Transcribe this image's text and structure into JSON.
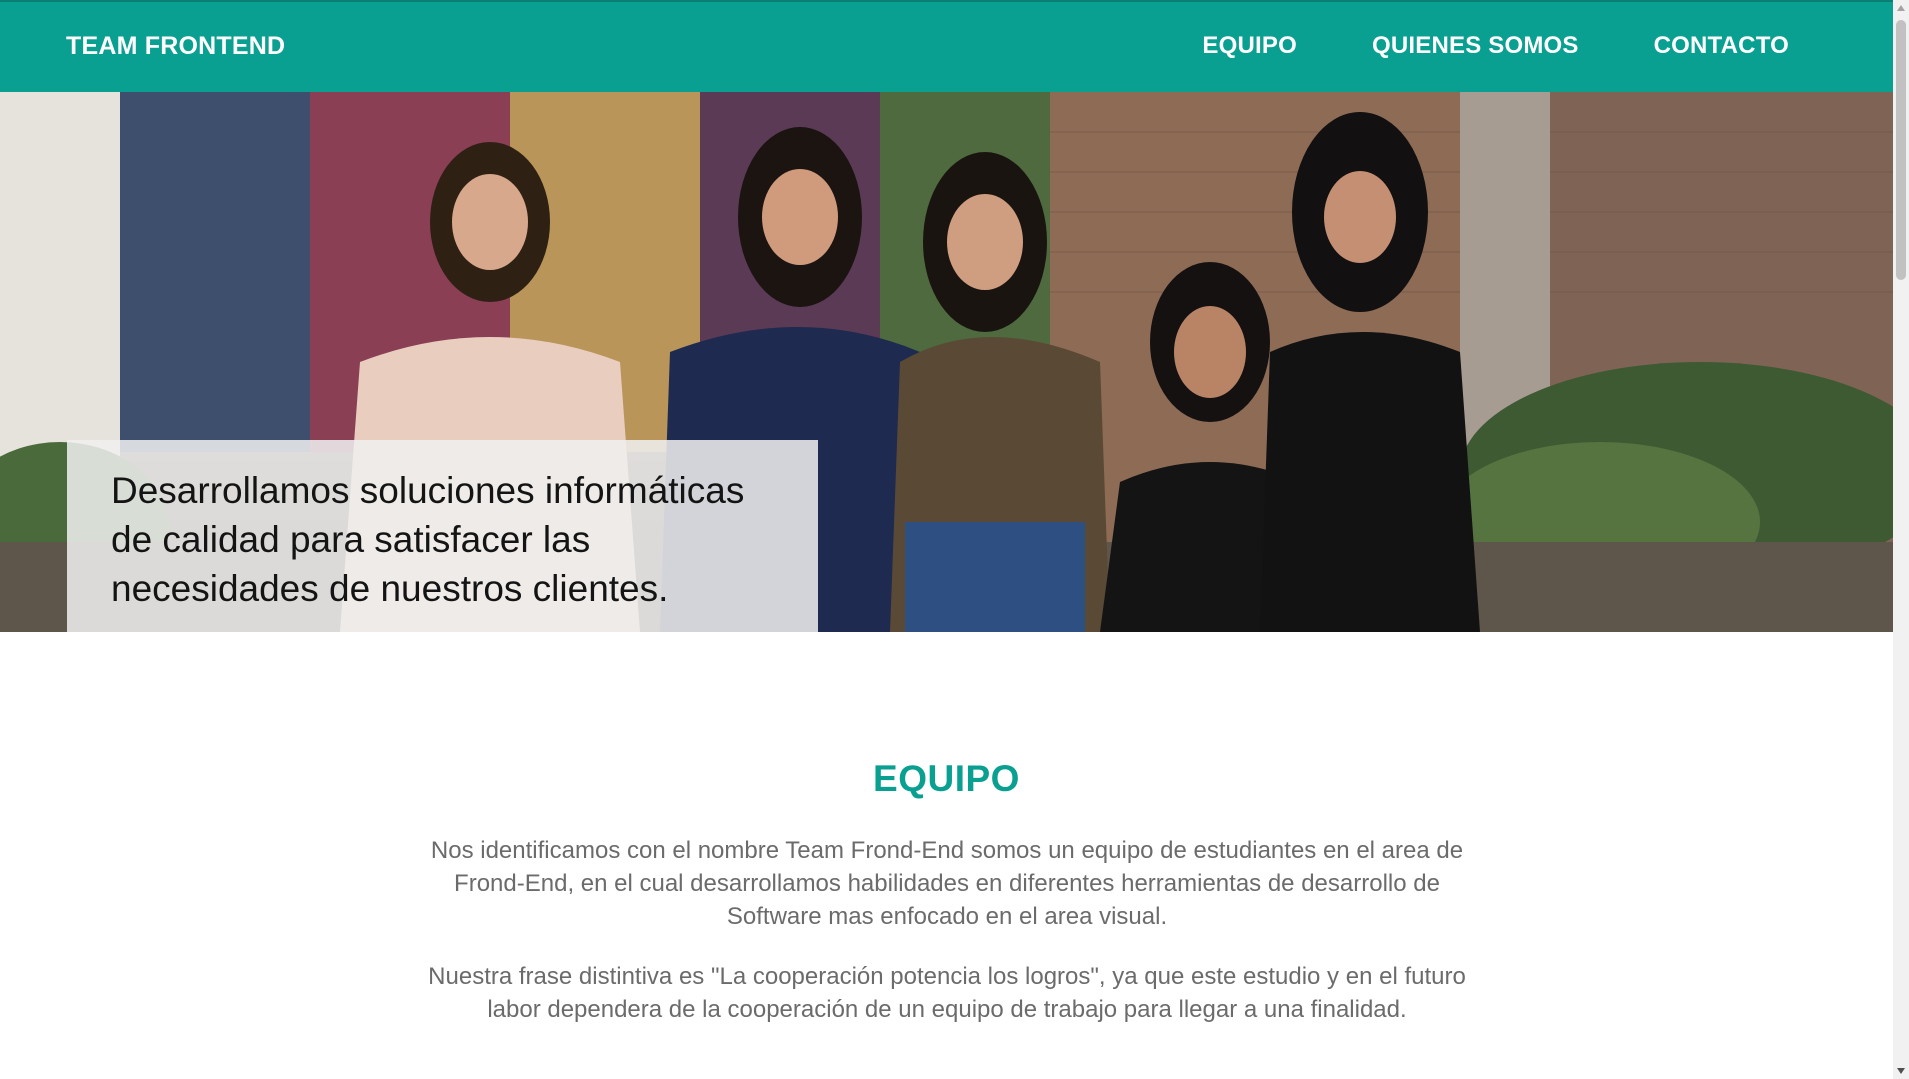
{
  "navbar": {
    "brand": "TEAM FRONTEND",
    "links": [
      "EQUIPO",
      "QUIENES SOMOS",
      "CONTACTO"
    ],
    "background_color": "#0aa091"
  },
  "hero": {
    "caption": "Desarrollamos soluciones informáticas de calidad para satisfacer las necesidades de nuestros clientes."
  },
  "equipo": {
    "title": "EQUIPO",
    "paragraphs": [
      "Nos identificamos con el nombre Team Frond-End somos un equipo de estudiantes en el area de Frond-End, en el cual desarrollamos habilidades en diferentes herramientas de desarrollo de Software mas enfocado en el area visual.",
      "Nuestra frase distintiva es \"La cooperación potencia los logros\", ya que este estudio y en el futuro labor dependera de la cooperación de un equipo de trabajo para llegar a una finalidad."
    ],
    "title_color": "#0aa091"
  }
}
